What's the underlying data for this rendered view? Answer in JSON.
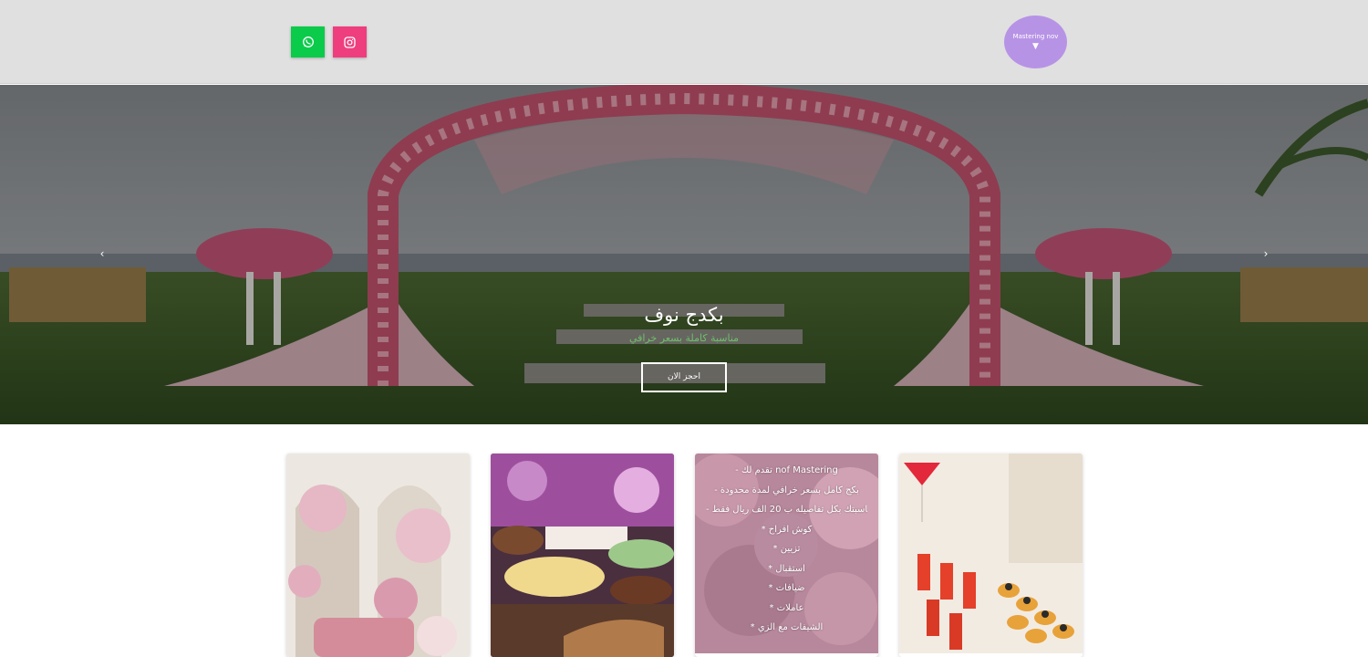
{
  "header": {
    "social": [
      {
        "name": "whatsapp",
        "icon": "whatsapp-icon",
        "color": "#0acb4a"
      },
      {
        "name": "instagram",
        "icon": "instagram-icon",
        "color": "#ee3e7d"
      }
    ],
    "logo": {
      "text": "Mastering nov",
      "mark": "▼",
      "color": "#b793e6"
    }
  },
  "hero": {
    "title": "بكدج نوف",
    "subtitle": "مناسبة كاملة بسعر خرافي",
    "cta_label": "احجز الان",
    "prev_arrow": "‹",
    "next_arrow": "›"
  },
  "cards": [
    {
      "image": "floral-arch-sofa-photo"
    },
    {
      "image": "dessert-buffet-photo"
    },
    {
      "image": "cherry-blossom-photo",
      "lines": [
        "- تقدم لك nof Mastering",
        "- بكج كامل بسعر خرافي لمدة محدودة",
        "- مناسبتك بكل تفاصيله ب 20 الف ريال فقط",
        "* كوش افراح",
        "* تزيين",
        "* استقبال",
        "* ضيافات",
        "* عاملات",
        "* الشيفات مع الزي"
      ]
    },
    {
      "image": "cocktails-canapes-photo"
    }
  ],
  "colors": {
    "header_bg": "#e0e0e0",
    "subtitle_green": "#6fc06a"
  }
}
